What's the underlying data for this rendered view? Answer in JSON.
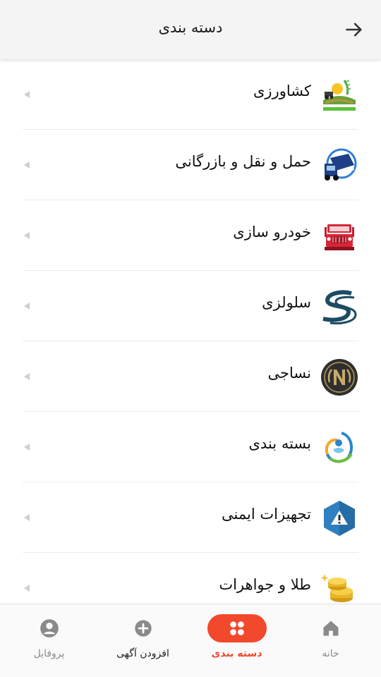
{
  "header": {
    "title": "دسته بندی"
  },
  "categories": [
    {
      "label": "کشاورزی"
    },
    {
      "label": "حمل و نقل و بازرگانی"
    },
    {
      "label": "خودرو سازی"
    },
    {
      "label": "سلولزی"
    },
    {
      "label": "نساجی"
    },
    {
      "label": "بسته بندی"
    },
    {
      "label": "تجهیزات ایمنی"
    },
    {
      "label": "طلا و جواهرات"
    }
  ],
  "bottom_nav": {
    "home": "خانه",
    "categories": "دسته بندی",
    "add_ad": "افزودن آگهی",
    "profile": "پروفایل"
  },
  "colors": {
    "accent": "#f2482b",
    "header_bg": "#f4f4f4",
    "nav_inactive": "#8a8a8a"
  }
}
